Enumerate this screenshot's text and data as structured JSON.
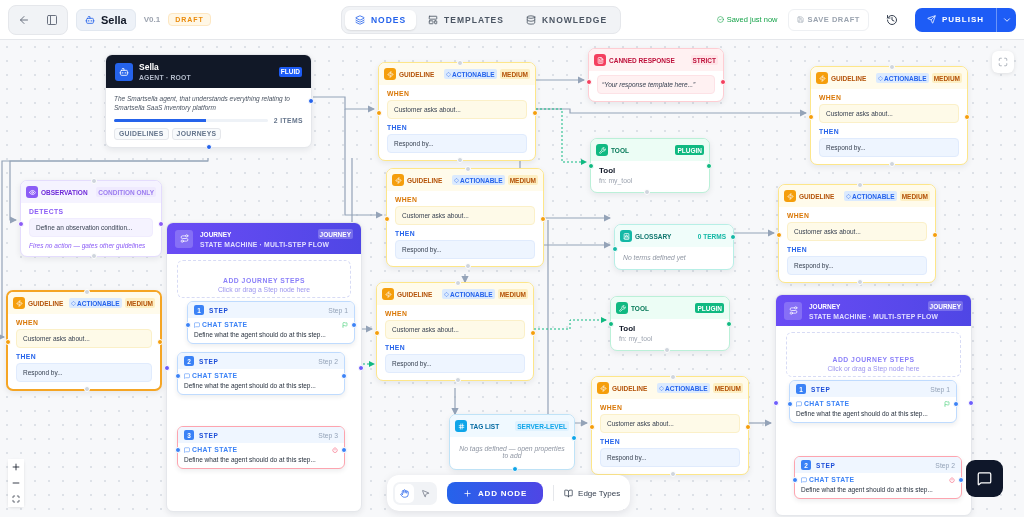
{
  "header": {
    "agent": "Sella",
    "version": "V0.1",
    "status": "DRAFT",
    "tabs": [
      {
        "label": "NODES",
        "selected": true
      },
      {
        "label": "TEMPLATES",
        "selected": false
      },
      {
        "label": "KNOWLEDGE",
        "selected": false
      }
    ],
    "saved": "Saved just now",
    "save_draft": {
      "label": "SAVE DRAFT",
      "disabled": true
    },
    "publish": "PUBLISH"
  },
  "nodes": [
    {
      "kind": "agent",
      "title": "Sella",
      "subtitle": "AGENT · ROOT",
      "badge": "FLUID",
      "description": "The Smartsella agent, that understands everything relating to Smartsella SaaS inventory platform",
      "level": 0.6,
      "count": "2 ITEMS",
      "tags": [
        "GUIDELINES",
        "JOURNEYS"
      ],
      "selected": false
    },
    {
      "kind": "guideline",
      "title": "GUIDELINE",
      "tag": "ACTIONABLE",
      "priority": "MEDIUM",
      "when_label": "WHEN",
      "when": "Customer asks about...",
      "then_label": "THEN",
      "then": "Respond by...",
      "selected": false
    },
    {
      "kind": "canned",
      "title": "CANNED RESPONSE",
      "badge": "STRICT",
      "text": "“Your response template here...”",
      "selected": false
    },
    {
      "kind": "guideline",
      "title": "GUIDELINE",
      "tag": "ACTIONABLE",
      "priority": "MEDIUM",
      "when_label": "WHEN",
      "when": "Customer asks about...",
      "then_label": "THEN",
      "then": "Respond by...",
      "selected": false
    },
    {
      "kind": "tool",
      "title": "TOOL",
      "badge": "PLUGIN",
      "name": "Tool",
      "fn": "fn: my_tool",
      "selected": false
    },
    {
      "kind": "observation",
      "title": "OBSERVATION",
      "badge": "CONDITION ONLY",
      "label": "DETECTS",
      "text": "Define an observation condition...",
      "note": "Fires no action — gates other guidelines",
      "selected": false
    },
    {
      "kind": "guideline",
      "title": "GUIDELINE",
      "tag": "ACTIONABLE",
      "priority": "MEDIUM",
      "when_label": "WHEN",
      "when": "Customer asks about...",
      "then_label": "THEN",
      "then": "Respond by...",
      "selected": false
    },
    {
      "kind": "glossary",
      "title": "GLOSSARY",
      "badge": "0 TERMS",
      "text": "No terms defined yet",
      "selected": false
    },
    {
      "kind": "guideline",
      "title": "GUIDELINE",
      "tag": "ACTIONABLE",
      "priority": "MEDIUM",
      "when_label": "WHEN",
      "when": "Customer asks about...",
      "then_label": "THEN",
      "then": "Respond by...",
      "selected": false
    },
    {
      "kind": "journey",
      "title": "JOURNEY",
      "subtitle": "STATE MACHINE · MULTI-STEP FLOW",
      "badge": "JOURNEY",
      "drop_title": "ADD JOURNEY STEPS",
      "drop_hint": "Click or drag a Step node here",
      "selected": false,
      "steps": [
        {
          "kind": "start",
          "number": "1",
          "title": "STEP",
          "step": "Step 1",
          "state": "CHAT STATE",
          "text": "Define what the agent should do at this step..."
        },
        {
          "kind": "normal",
          "number": "2",
          "title": "STEP",
          "step": "Step 2",
          "state": "CHAT STATE",
          "text": "Define what the agent should do at this step..."
        },
        {
          "kind": "end",
          "number": "3",
          "title": "STEP",
          "step": "Step 3",
          "state": "CHAT STATE",
          "text": "Define what the agent should do at this step..."
        }
      ]
    },
    {
      "kind": "guideline",
      "title": "GUIDELINE",
      "tag": "ACTIONABLE",
      "priority": "MEDIUM",
      "when_label": "WHEN",
      "when": "Customer asks about...",
      "then_label": "THEN",
      "then": "Respond by...",
      "selected": true
    },
    {
      "kind": "guideline",
      "title": "GUIDELINE",
      "tag": "ACTIONABLE",
      "priority": "MEDIUM",
      "when_label": "WHEN",
      "when": "Customer asks about...",
      "then_label": "THEN",
      "then": "Respond by...",
      "selected": false
    },
    {
      "kind": "tool",
      "title": "TOOL",
      "badge": "PLUGIN",
      "name": "Tool",
      "fn": "fn: my_tool",
      "selected": false
    },
    {
      "kind": "journey",
      "title": "JOURNEY",
      "subtitle": "STATE MACHINE · MULTI-STEP FLOW",
      "badge": "JOURNEY",
      "drop_title": "ADD JOURNEY STEPS",
      "drop_hint": "Click or drag a Step node here",
      "selected": false,
      "steps": [
        {
          "kind": "start",
          "number": "1",
          "title": "STEP",
          "step": "Step 1",
          "state": "CHAT STATE",
          "text": "Define what the agent should do at this step..."
        },
        {
          "kind": "end",
          "number": "2",
          "title": "STEP",
          "step": "Step 2",
          "state": "CHAT STATE",
          "text": "Define what the agent should do at this step..."
        }
      ]
    },
    {
      "kind": "guideline",
      "title": "GUIDELINE",
      "tag": "ACTIONABLE",
      "priority": "MEDIUM",
      "when_label": "WHEN",
      "when": "Customer asks about...",
      "then_label": "THEN",
      "then": "Respond by...",
      "selected": false
    },
    {
      "kind": "taglist",
      "title": "TAG LIST",
      "badge": "SERVER-LEVEL",
      "text": "No tags defined — open properties to add",
      "selected": false
    }
  ],
  "canvas_tools": [
    {
      "kind": "hand",
      "selected": true
    },
    {
      "kind": "pointer",
      "selected": false
    }
  ],
  "add_node": "ADD NODE",
  "edge_types": "Edge Types"
}
